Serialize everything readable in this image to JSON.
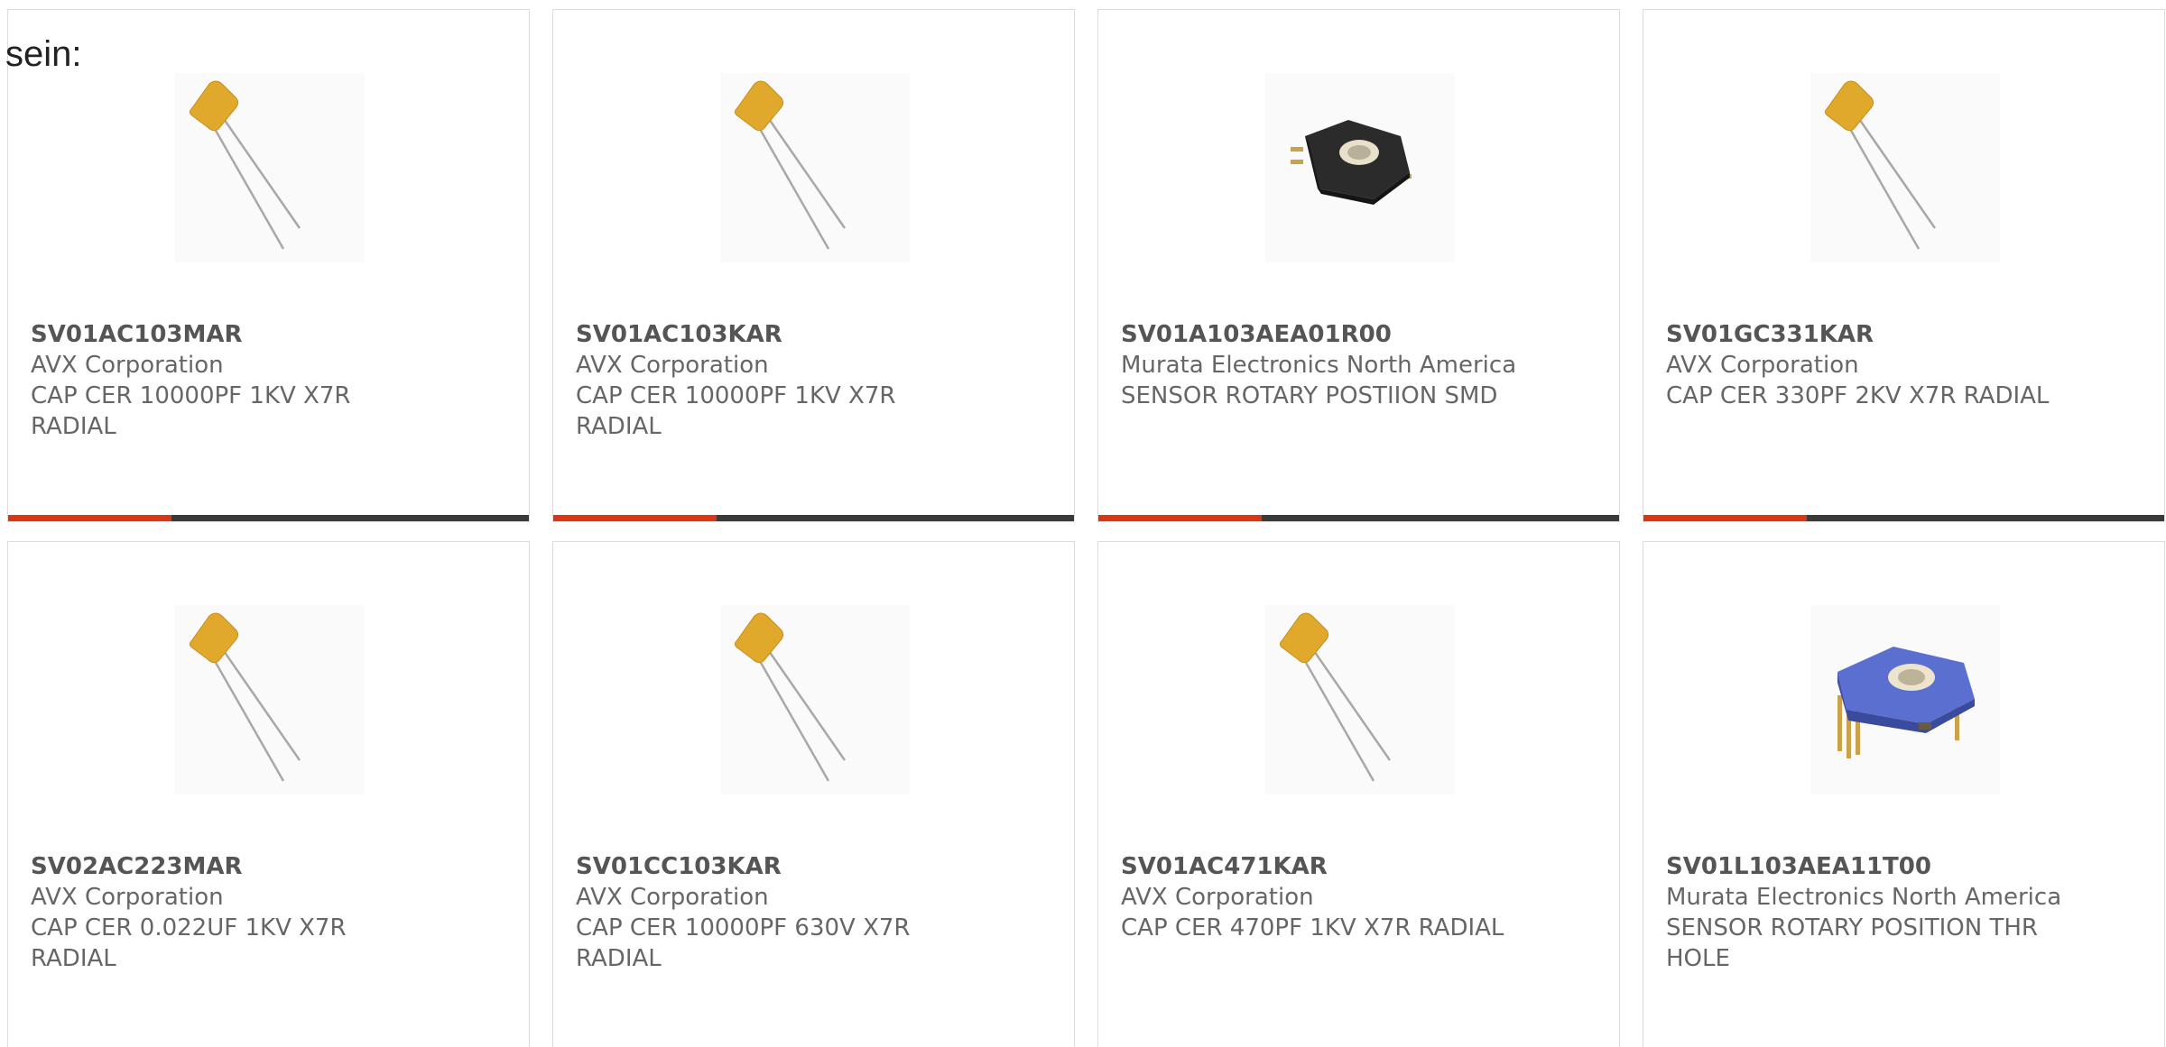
{
  "intro_text": "sein:",
  "products": [
    {
      "part": "SV01AC103MAR",
      "manufacturer": "AVX Corporation",
      "description": "CAP CER 10000PF 1KV X7R RADIAL",
      "image": "capacitor-image"
    },
    {
      "part": "SV01AC103KAR",
      "manufacturer": "AVX Corporation",
      "description": "CAP CER 10000PF 1KV X7R RADIAL",
      "image": "capacitor-image"
    },
    {
      "part": "SV01A103AEA01R00",
      "manufacturer": "Murata Electronics North America",
      "description": "SENSOR ROTARY POSTIION SMD",
      "image": "rotary-sensor-black-image"
    },
    {
      "part": "SV01GC331KAR",
      "manufacturer": "AVX Corporation",
      "description": "CAP CER 330PF 2KV X7R RADIAL",
      "image": "capacitor-image"
    },
    {
      "part": "SV02AC223MAR",
      "manufacturer": "AVX Corporation",
      "description": "CAP CER 0.022UF 1KV X7R RADIAL",
      "image": "capacitor-image"
    },
    {
      "part": "SV01CC103KAR",
      "manufacturer": "AVX Corporation",
      "description": "CAP CER 10000PF 630V X7R RADIAL",
      "image": "capacitor-image"
    },
    {
      "part": "SV01AC471KAR",
      "manufacturer": "AVX Corporation",
      "description": "CAP CER 470PF 1KV X7R RADIAL",
      "image": "capacitor-image"
    },
    {
      "part": "SV01L103AEA11T00",
      "manufacturer": "Murata Electronics North America",
      "description": "SENSOR ROTARY POSITION THR HOLE",
      "image": "rotary-sensor-blue-image"
    }
  ],
  "colors": {
    "accent": "#d93612",
    "bar_dark": "#3a3a3a",
    "capacitor_body": "#e0a92c",
    "sensor_black": "#2b2b2b",
    "sensor_blue": "#5b6fd0"
  }
}
